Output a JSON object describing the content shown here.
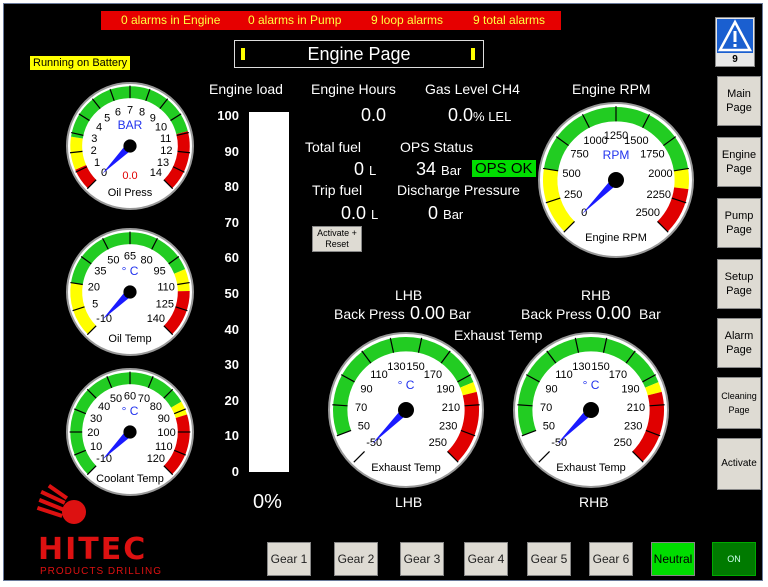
{
  "alarms": {
    "engine": "0  alarms in Engine",
    "pump": "0  alarms in Pump",
    "loop": "9  loop alarms",
    "total": "9  total alarms"
  },
  "status": {
    "battery": "Running on Battery"
  },
  "page_title": "Engine Page",
  "warning_badge": {
    "count": "9"
  },
  "nav": [
    {
      "label": "Main Page"
    },
    {
      "label": "Engine Page"
    },
    {
      "label": "Pump Page"
    },
    {
      "label": "Setup Page"
    },
    {
      "label": "Alarm Page"
    },
    {
      "label": "Cleaning Page"
    },
    {
      "label": "Activate"
    }
  ],
  "gears": [
    "Gear 1",
    "Gear 2",
    "Gear 3",
    "Gear 4",
    "Gear 5",
    "Gear 6"
  ],
  "neutral_label": "Neutral",
  "on_label": "ON",
  "engine_load": {
    "title": "Engine load",
    "ticks": [
      "100",
      "90",
      "80",
      "70",
      "60",
      "50",
      "40",
      "30",
      "20",
      "10",
      "0"
    ],
    "value_text": "0%",
    "value": 0
  },
  "readings": {
    "engine_hours_label": "Engine Hours",
    "engine_hours": "0.0",
    "gas_level_label": "Gas Level CH4",
    "gas_level": "0.0",
    "gas_unit": "% LEL",
    "total_fuel_label": "Total fuel",
    "total_fuel": "0",
    "total_fuel_unit": "L",
    "ops_status_label": "OPS Status",
    "ops_value": "34",
    "ops_unit": "Bar",
    "ops_ok": "OPS OK",
    "trip_fuel_label": "Trip fuel",
    "trip_fuel": "0.0",
    "trip_fuel_unit": "L",
    "discharge_label": "Discharge Pressure",
    "discharge": "0",
    "discharge_unit": "Bar",
    "reset_label": "Activate + Reset"
  },
  "exhaust": {
    "title": "Exhaust Temp",
    "lhb_label": "LHB",
    "rhb_label": "RHB",
    "back_press_label": "Back Press",
    "lhb_back_press": "0.00",
    "rhb_back_press": "0.00",
    "unit": "Bar",
    "lhb_bottom": "LHB",
    "rhb_bottom": "RHB"
  },
  "gauges": {
    "oil_press": {
      "unit": "BAR",
      "label": "Oil Press",
      "readout": "0.0",
      "ticks": [
        "0",
        "1",
        "2",
        "3",
        "4",
        "5",
        "6",
        "7",
        "8",
        "9",
        "10",
        "11",
        "12",
        "13",
        "14"
      ],
      "value": 0,
      "min": 0,
      "max": 14
    },
    "oil_temp": {
      "unit": "° C",
      "label": "Oil Temp",
      "ticks": [
        "-10",
        "5",
        "20",
        "35",
        "50",
        "65",
        "80",
        "95",
        "110",
        "125",
        "140"
      ],
      "value": -10,
      "min": -10,
      "max": 140
    },
    "coolant_temp": {
      "unit": "° C",
      "label": "Coolant Temp",
      "ticks": [
        "-10",
        "10",
        "20",
        "30",
        "40",
        "50",
        "60",
        "70",
        "80",
        "90",
        "100",
        "110",
        "120"
      ],
      "value": -10,
      "min": -10,
      "max": 120
    },
    "engine_rpm": {
      "unit": "RPM",
      "label": "Engine RPM",
      "ticks": [
        "0",
        "250",
        "500",
        "750",
        "1000",
        "1250",
        "1500",
        "1750",
        "2000",
        "2250",
        "2500"
      ],
      "value": 0,
      "min": 0,
      "max": 2500
    },
    "exhaust_lhb": {
      "unit": "° C",
      "label": "Exhaust Temp",
      "ticks": [
        "-50",
        "50",
        "70",
        "90",
        "110",
        "130",
        "150",
        "170",
        "190",
        "210",
        "230",
        "250"
      ],
      "value": -50,
      "min": -50,
      "max": 250
    },
    "exhaust_rhb": {
      "unit": "° C",
      "label": "Exhaust Temp",
      "ticks": [
        "-50",
        "50",
        "70",
        "90",
        "110",
        "130",
        "150",
        "170",
        "190",
        "210",
        "230",
        "250"
      ],
      "value": -50,
      "min": -50,
      "max": 250
    }
  },
  "logo": {
    "brand": "HITEC",
    "sub": "PRODUCTS DRILLING"
  },
  "colors": {
    "alarm_bar": "#e60000",
    "alarm_text": "#ffff40",
    "ok_green": "#00dd00",
    "zone_green": "#22cc22",
    "zone_yellow": "#ffff00",
    "zone_red": "#e00000",
    "needle": "#1a1aff",
    "logo_red": "#dd1111"
  }
}
